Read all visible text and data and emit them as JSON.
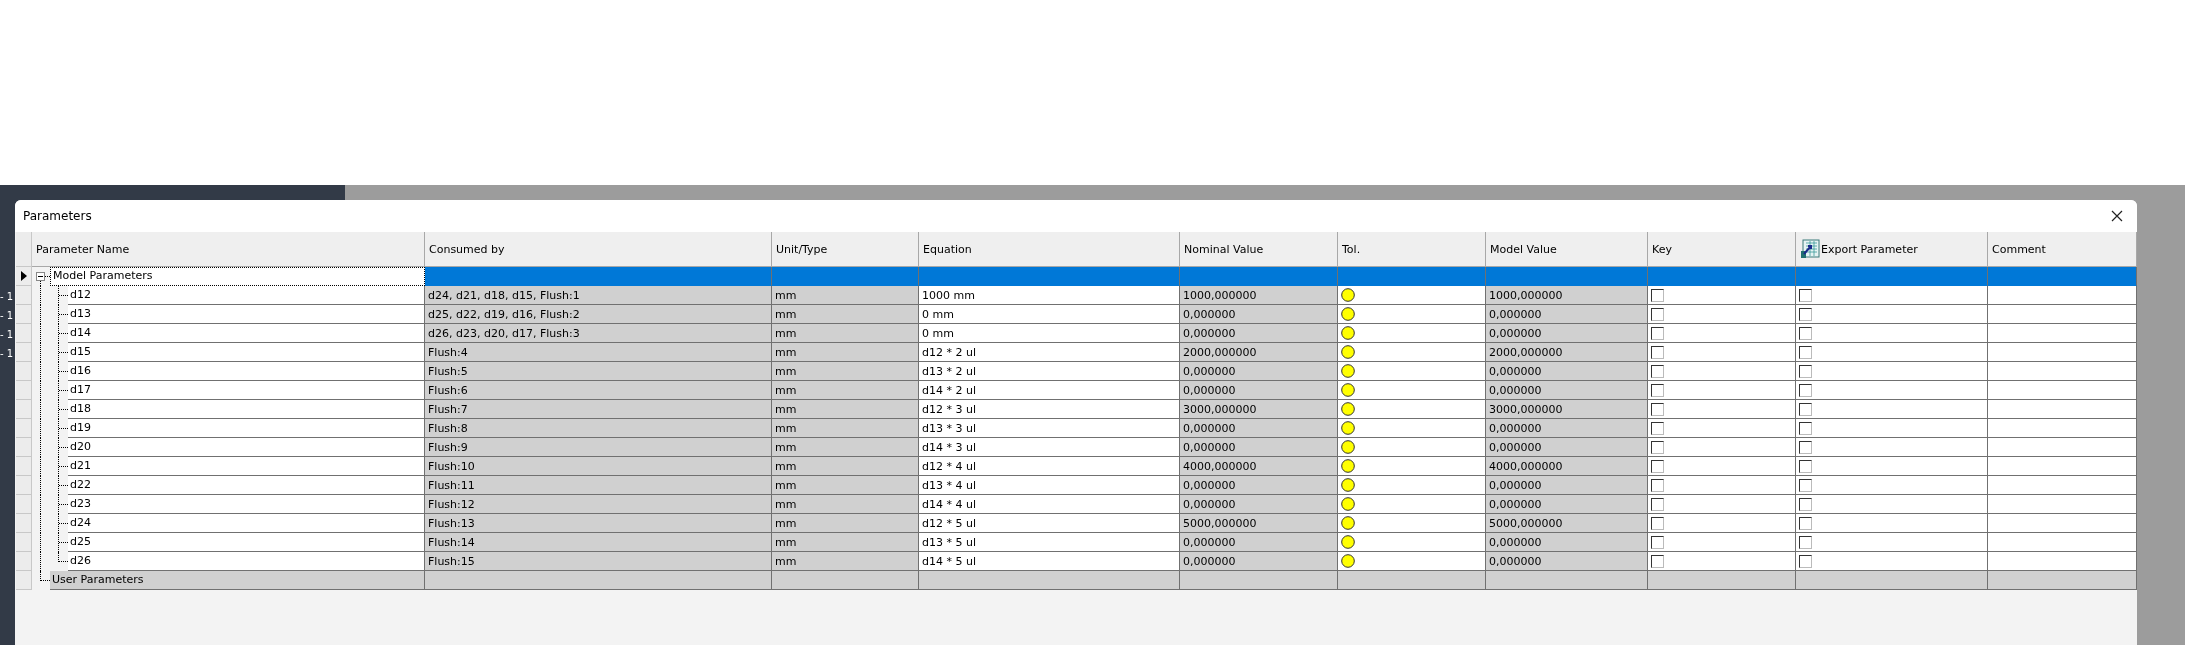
{
  "side_labels": [
    "- 1",
    "- 1",
    "- 1",
    "- 1"
  ],
  "window": {
    "title": "Parameters"
  },
  "columns": [
    "Parameter Name",
    "Consumed by",
    "Unit/Type",
    "Equation",
    "Nominal Value",
    "Tol.",
    "Model Value",
    "Key",
    "Export Parameter",
    "Comment"
  ],
  "groups": [
    {
      "name": "Model Parameters",
      "selected": true,
      "expanded": true,
      "children": [
        {
          "name": "d12",
          "consumed_by": "d24, d21, d18, d15, Flush:1",
          "unit": "mm",
          "equation": "1000 mm",
          "nominal": "1000,000000",
          "model_value": "1000,000000",
          "key": false,
          "export": false
        },
        {
          "name": "d13",
          "consumed_by": "d25, d22, d19, d16, Flush:2",
          "unit": "mm",
          "equation": "0 mm",
          "nominal": "0,000000",
          "model_value": "0,000000",
          "key": false,
          "export": false
        },
        {
          "name": "d14",
          "consumed_by": "d26, d23, d20, d17, Flush:3",
          "unit": "mm",
          "equation": "0 mm",
          "nominal": "0,000000",
          "model_value": "0,000000",
          "key": false,
          "export": false
        },
        {
          "name": "d15",
          "consumed_by": "Flush:4",
          "unit": "mm",
          "equation": "d12 * 2 ul",
          "nominal": "2000,000000",
          "model_value": "2000,000000",
          "key": false,
          "export": false
        },
        {
          "name": "d16",
          "consumed_by": "Flush:5",
          "unit": "mm",
          "equation": "d13 * 2 ul",
          "nominal": "0,000000",
          "model_value": "0,000000",
          "key": false,
          "export": false
        },
        {
          "name": "d17",
          "consumed_by": "Flush:6",
          "unit": "mm",
          "equation": "d14 * 2 ul",
          "nominal": "0,000000",
          "model_value": "0,000000",
          "key": false,
          "export": false
        },
        {
          "name": "d18",
          "consumed_by": "Flush:7",
          "unit": "mm",
          "equation": "d12 * 3 ul",
          "nominal": "3000,000000",
          "model_value": "3000,000000",
          "key": false,
          "export": false
        },
        {
          "name": "d19",
          "consumed_by": "Flush:8",
          "unit": "mm",
          "equation": "d13 * 3 ul",
          "nominal": "0,000000",
          "model_value": "0,000000",
          "key": false,
          "export": false
        },
        {
          "name": "d20",
          "consumed_by": "Flush:9",
          "unit": "mm",
          "equation": "d14 * 3 ul",
          "nominal": "0,000000",
          "model_value": "0,000000",
          "key": false,
          "export": false
        },
        {
          "name": "d21",
          "consumed_by": "Flush:10",
          "unit": "mm",
          "equation": "d12 * 4 ul",
          "nominal": "4000,000000",
          "model_value": "4000,000000",
          "key": false,
          "export": false
        },
        {
          "name": "d22",
          "consumed_by": "Flush:11",
          "unit": "mm",
          "equation": "d13 * 4 ul",
          "nominal": "0,000000",
          "model_value": "0,000000",
          "key": false,
          "export": false
        },
        {
          "name": "d23",
          "consumed_by": "Flush:12",
          "unit": "mm",
          "equation": "d14 * 4 ul",
          "nominal": "0,000000",
          "model_value": "0,000000",
          "key": false,
          "export": false
        },
        {
          "name": "d24",
          "consumed_by": "Flush:13",
          "unit": "mm",
          "equation": "d12 * 5 ul",
          "nominal": "5000,000000",
          "model_value": "5000,000000",
          "key": false,
          "export": false
        },
        {
          "name": "d25",
          "consumed_by": "Flush:14",
          "unit": "mm",
          "equation": "d13 * 5 ul",
          "nominal": "0,000000",
          "model_value": "0,000000",
          "key": false,
          "export": false
        },
        {
          "name": "d26",
          "consumed_by": "Flush:15",
          "unit": "mm",
          "equation": "d14 * 5 ul",
          "nominal": "0,000000",
          "model_value": "0,000000",
          "key": false,
          "export": false
        }
      ]
    },
    {
      "name": "User Parameters",
      "selected": false
    }
  ]
}
